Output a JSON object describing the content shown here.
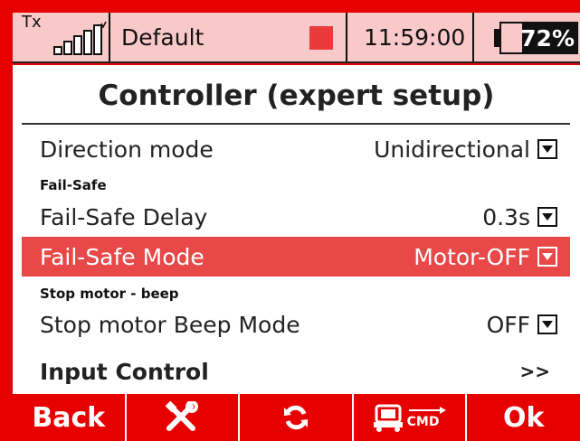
{
  "status": {
    "tx_label": "Tx",
    "model_name": "Default",
    "time": "11:59:00",
    "battery_percent": "72%",
    "battery_level": 0.72,
    "signal_bars": 5
  },
  "page": {
    "title": "Controller (expert setup)"
  },
  "settings": {
    "direction": {
      "label": "Direction mode",
      "value": "Unidirectional"
    },
    "failsafe_section": "Fail-Safe",
    "failsafe_delay": {
      "label": "Fail-Safe Delay",
      "value": "0.3s"
    },
    "failsafe_mode": {
      "label": "Fail-Safe Mode",
      "value": "Motor-OFF"
    },
    "stop_section": "Stop motor - beep",
    "stop_beep": {
      "label": "Stop motor Beep Mode",
      "value": "OFF"
    },
    "input_control": {
      "label": "Input Control",
      "value": ">>"
    }
  },
  "footer": {
    "back": "Back",
    "cmd": "CMD",
    "ok": "Ok",
    "icons": [
      "wrench-cross-icon",
      "refresh-icon",
      "cmd-device-icon"
    ]
  },
  "colors": {
    "accent": "#e60000",
    "selected_row": "#e84848",
    "status_bg": "#f9c8c8"
  }
}
